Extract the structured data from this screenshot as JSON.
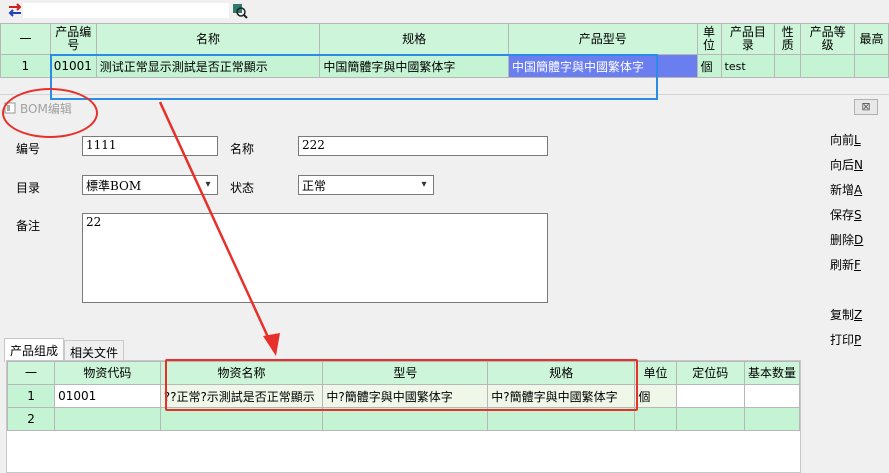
{
  "top": {
    "search_value": "",
    "headers": [
      "一",
      "产品编号",
      "名称",
      "规格",
      "产品型号",
      "单位",
      "产品目录",
      "性质",
      "产品等级",
      "最高"
    ],
    "row": {
      "index": "1",
      "code": "01001",
      "name": "测试正常显示測試是否正常顯示",
      "spec": "中国簡體字與中國繁体字",
      "model": "中国簡體字與中國繁体字",
      "unit": "個",
      "catalog": "test",
      "nature": "",
      "grade": "",
      "max": ""
    }
  },
  "bom": {
    "title": "BOM编辑",
    "close_label": "⊠",
    "labels": {
      "code": "编号",
      "name": "名称",
      "catalog": "目录",
      "status": "状态",
      "remark": "备注"
    },
    "values": {
      "code": "1111",
      "name": "222",
      "catalog": "標準BOM",
      "status": "正常",
      "remark": "22"
    },
    "side_buttons": [
      {
        "text": "向前",
        "key": "L"
      },
      {
        "text": "向后",
        "key": "N"
      },
      {
        "text": "新增",
        "key": "A"
      },
      {
        "text": "保存",
        "key": "S"
      },
      {
        "text": "删除",
        "key": "D"
      },
      {
        "text": "刷新",
        "key": "F"
      },
      {
        "text": "复制",
        "key": "Z"
      },
      {
        "text": "打印",
        "key": "P"
      }
    ],
    "tabs": [
      "产品组成",
      "相关文件"
    ],
    "grid": {
      "headers": [
        "一",
        "物资代码",
        "物资名称",
        "型号",
        "规格",
        "单位",
        "定位码",
        "基本数量"
      ],
      "rows": [
        {
          "index": "1",
          "code": "01001",
          "name": "??正常?示測試是否正常顯示",
          "model": "中?簡體字與中國繁体字",
          "spec": "中?簡體字與中國繁体字",
          "unit": "個",
          "pos": "",
          "qty": ""
        },
        {
          "index": "2",
          "code": "",
          "name": "",
          "model": "",
          "spec": "",
          "unit": "",
          "pos": "",
          "qty": ""
        }
      ]
    }
  },
  "colors": {
    "header_bg": "#ccf5d9",
    "row_bg": "#c4f4d4",
    "selected_bg": "#6a7ef0",
    "annotation_red": "#e8302a",
    "annotation_blue": "#2b8ce8"
  }
}
